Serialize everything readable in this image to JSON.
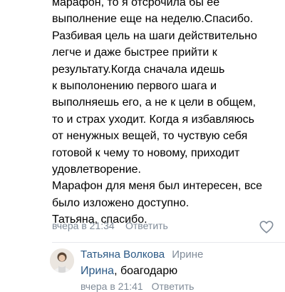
{
  "comment": {
    "lines": [
      "марафон, то я отсрочила бы ее",
      "выполнение еще на неделю.Спасибо.",
      "Разбивая цель на шаги действительно",
      "легче и даже быстрее прийти к",
      "результату.Когда сначала идешь",
      "к выполонению первого шага и",
      "выполняешь его, а не к цели в общем,",
      "то и страх уходит. Когда я избавляюсь",
      "от ненужных вещей, то чуствую себя",
      "готовой к чему то новому, приходит",
      "удовлетворение.",
      "Марафон для меня был интересен, все",
      "было изложено доступно.",
      "Татьяна, спасибо."
    ],
    "time": "вчера в 21:34",
    "reply_label": "Ответить",
    "like_icon": "heart-icon"
  },
  "reply": {
    "author": "Татьяна Волкова",
    "to": "Ирине",
    "mention": "Ирина",
    "text": ", боагодарю",
    "time": "вчера в 21:41",
    "reply_label": "Ответить"
  },
  "colors": {
    "link": "#2a5885",
    "meta": "#818c99",
    "divider": "#e7e8ec"
  }
}
